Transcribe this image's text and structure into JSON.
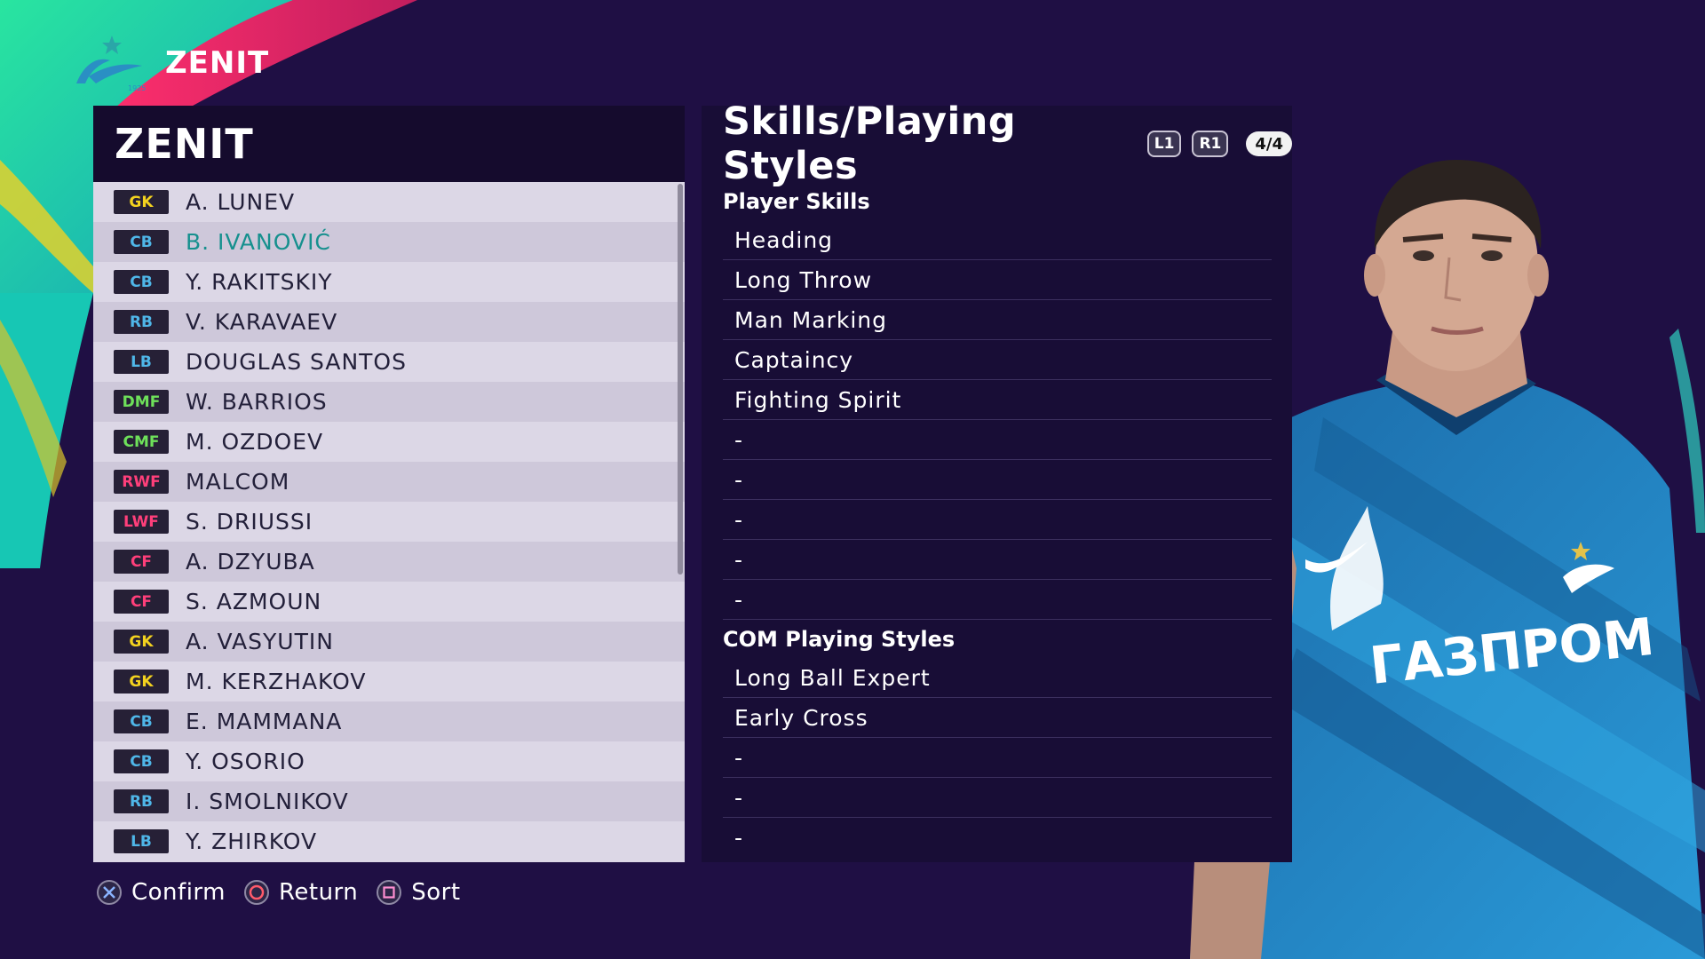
{
  "header": {
    "club_name": "ZENIT",
    "logo_icon": "zenit-logo-icon"
  },
  "list": {
    "title": "ZENIT",
    "players": [
      {
        "pos": "GK",
        "name": "A. LUNEV",
        "color": "#f3d21f"
      },
      {
        "pos": "CB",
        "name": "B. IVANOVIĆ",
        "color": "#4fb6e8",
        "selected": true
      },
      {
        "pos": "CB",
        "name": "Y. RAKITSKIY",
        "color": "#4fb6e8"
      },
      {
        "pos": "RB",
        "name": "V. KARAVAEV",
        "color": "#4fb6e8"
      },
      {
        "pos": "LB",
        "name": "DOUGLAS SANTOS",
        "color": "#4fb6e8"
      },
      {
        "pos": "DMF",
        "name": "W. BARRIOS",
        "color": "#6ee05a"
      },
      {
        "pos": "CMF",
        "name": "M. OZDOEV",
        "color": "#6ee05a"
      },
      {
        "pos": "RWF",
        "name": "MALCOM",
        "color": "#ff3f7a"
      },
      {
        "pos": "LWF",
        "name": "S. DRIUSSI",
        "color": "#ff3f7a"
      },
      {
        "pos": "CF",
        "name": "A. DZYUBA",
        "color": "#ff3f7a"
      },
      {
        "pos": "CF",
        "name": "S. AZMOUN",
        "color": "#ff3f7a"
      },
      {
        "pos": "GK",
        "name": "A. VASYUTIN",
        "color": "#f3d21f"
      },
      {
        "pos": "GK",
        "name": "M. KERZHAKOV",
        "color": "#f3d21f"
      },
      {
        "pos": "CB",
        "name": "E. MAMMANA",
        "color": "#4fb6e8"
      },
      {
        "pos": "CB",
        "name": "Y. OSORIO",
        "color": "#4fb6e8"
      },
      {
        "pos": "RB",
        "name": "I. SMOLNIKOV",
        "color": "#4fb6e8"
      },
      {
        "pos": "LB",
        "name": "Y. ZHIRKOV",
        "color": "#4fb6e8"
      }
    ]
  },
  "skills": {
    "title": "Skills/Playing Styles",
    "l1_label": "L1",
    "r1_label": "R1",
    "page": "4/4",
    "player_skills_label": "Player Skills",
    "player_skills": [
      "Heading",
      "Long Throw",
      "Man Marking",
      "Captaincy",
      "Fighting Spirit",
      "-",
      "-",
      "-",
      "-",
      "-"
    ],
    "com_styles_label": "COM Playing Styles",
    "com_styles": [
      "Long Ball Expert",
      "Early Cross",
      "-",
      "-",
      "-"
    ]
  },
  "sponsor_text": "ГАЗПРОМ",
  "footer": {
    "confirm_label": "Confirm",
    "return_label": "Return",
    "sort_label": "Sort"
  },
  "colors": {
    "background": "#1f0f44",
    "panel_dark": "#150b2d",
    "list_row_light": "#dcd7e6",
    "list_row_alt": "#cec8da",
    "selected_name": "#16908e",
    "shirt_blue": "#1d7fc0"
  }
}
